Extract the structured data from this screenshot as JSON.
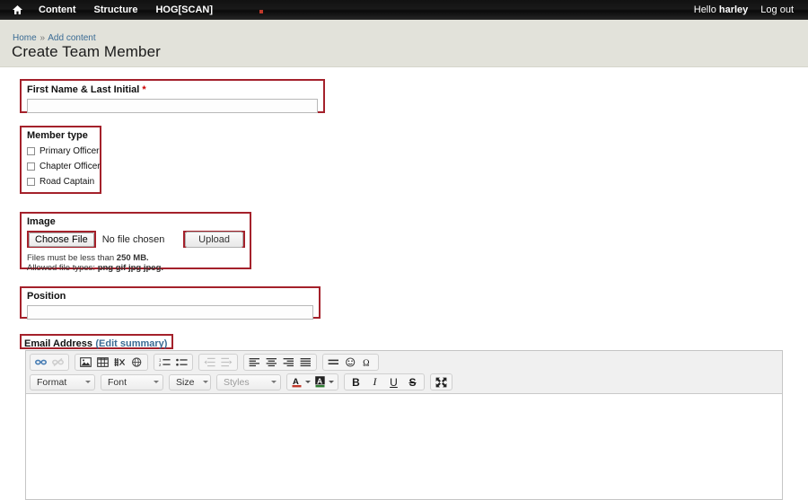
{
  "toolbar": {
    "home_icon": "home-icon",
    "items": [
      {
        "label": "Content"
      },
      {
        "label": "Structure"
      },
      {
        "label": "HOG[SCAN]"
      }
    ],
    "hello_prefix": "Hello ",
    "username": "harley",
    "logout_label": "Log out"
  },
  "breadcrumb": {
    "home": "Home",
    "separator": "»",
    "current": "Add content"
  },
  "page": {
    "title": "Create Team Member"
  },
  "form": {
    "first_name": {
      "label": "First Name & Last Initial",
      "required_marker": "*",
      "value": ""
    },
    "member_type": {
      "label": "Member type",
      "options": [
        {
          "label": "Primary Officer",
          "checked": false
        },
        {
          "label": "Chapter Officer",
          "checked": false
        },
        {
          "label": "Road Captain",
          "checked": false
        }
      ]
    },
    "image": {
      "label": "Image",
      "choose_file_label": "Choose File",
      "no_file_text": "No file chosen",
      "upload_label": "Upload",
      "help_line1_prefix": "Files must be less than ",
      "help_line1_value": "250 MB.",
      "help_line2_prefix": "Allowed file types: ",
      "help_line2_value": "png gif jpg jpeg."
    },
    "position": {
      "label": "Position",
      "value": ""
    },
    "email_address": {
      "label": "Email Address",
      "edit_summary_label": "(Edit summary)"
    }
  },
  "editor": {
    "row1": {
      "group1": [
        {
          "icon": "link-icon",
          "disabled": false
        },
        {
          "icon": "unlink-icon",
          "disabled": true
        }
      ],
      "group2": [
        {
          "icon": "image-icon",
          "disabled": false
        },
        {
          "icon": "table-icon",
          "disabled": false
        },
        {
          "icon": "media-icon",
          "disabled": false
        },
        {
          "icon": "globe-icon",
          "disabled": false
        }
      ],
      "group3": [
        {
          "icon": "numbered-list-icon",
          "disabled": false
        },
        {
          "icon": "bulleted-list-icon",
          "disabled": false
        }
      ],
      "group4": [
        {
          "icon": "outdent-icon",
          "disabled": true
        },
        {
          "icon": "indent-icon",
          "disabled": true
        }
      ],
      "group5": [
        {
          "icon": "align-left-icon",
          "disabled": false
        },
        {
          "icon": "align-center-icon",
          "disabled": false
        },
        {
          "icon": "align-right-icon",
          "disabled": false
        },
        {
          "icon": "align-justify-icon",
          "disabled": false
        }
      ],
      "group6": [
        {
          "icon": "horizontal-rule-icon",
          "disabled": false
        },
        {
          "icon": "smiley-icon",
          "disabled": false
        },
        {
          "icon": "special-character-icon",
          "disabled": false
        }
      ]
    },
    "row2": {
      "format_label": "Format",
      "font_label": "Font",
      "size_label": "Size",
      "styles_label": "Styles",
      "text_color_icon": "text-color-icon",
      "bg_color_icon": "background-color-icon",
      "bold_label": "B",
      "italic_label": "I",
      "underline_label": "U",
      "strike_label": "S",
      "maximize_icon": "maximize-icon"
    },
    "content": ""
  },
  "colors": {
    "annotation_red": "#a4212b",
    "link_blue": "#3a6b94",
    "required_red": "#cc0000",
    "header_band": "#e2e2da",
    "toolbar_black": "#111111",
    "toolbar_dot_red": "#c0392b"
  }
}
